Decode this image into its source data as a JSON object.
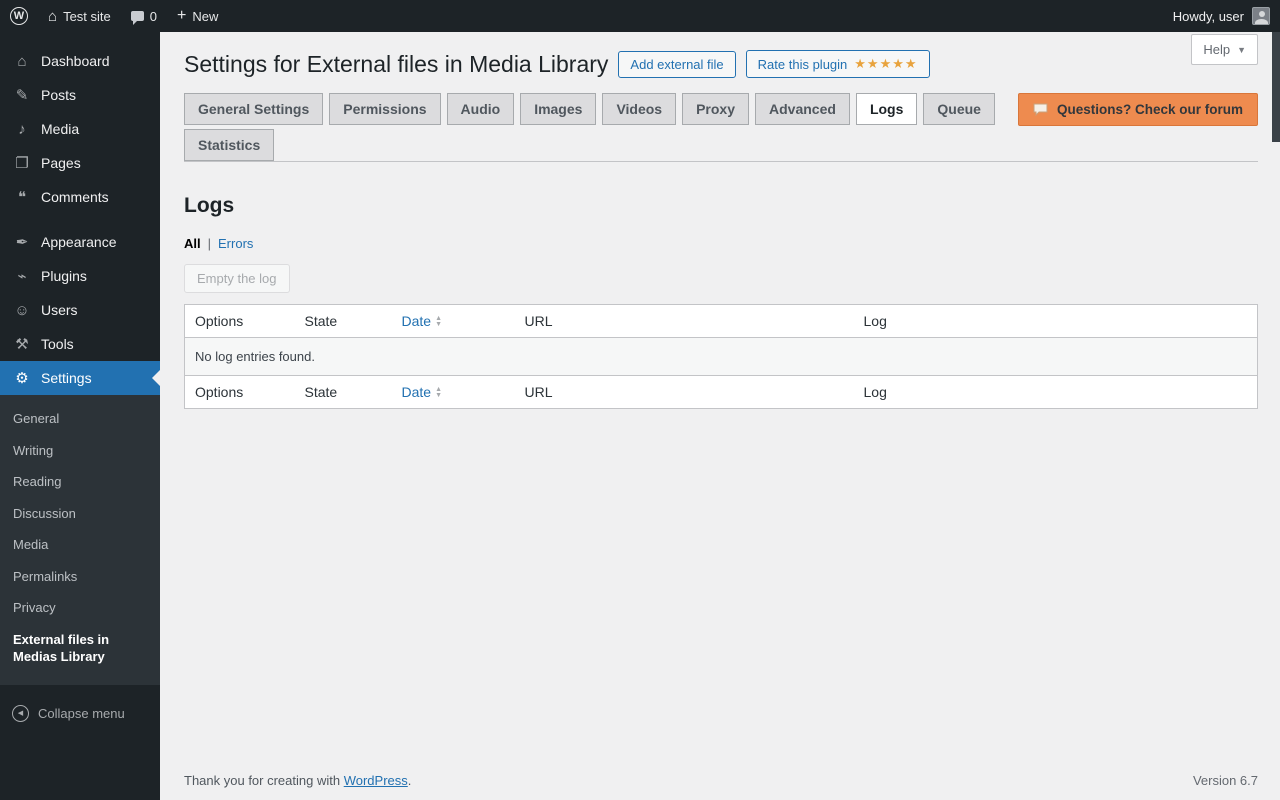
{
  "colors": {
    "accent_blue": "#2271b1",
    "admin_dark": "#1d2327",
    "forum_orange": "#ee8b4f",
    "star_orange": "#e8a33d",
    "content_bg": "#f0f0f1"
  },
  "admin_bar": {
    "site_name": "Test site",
    "comment_count": "0",
    "new_label": "New",
    "howdy_text": "Howdy, user"
  },
  "icons": {
    "wordpress_logo": "W",
    "home": "⌂",
    "plus": "+",
    "dashboard": "⌂",
    "posts": "✎",
    "media": "♪",
    "pages": "❐",
    "comments": "❝",
    "appearance": "✒",
    "plugins": "⌁",
    "users": "☺",
    "tools": "⚒",
    "settings": "⚙",
    "collapse_arrow": "◀",
    "caret_down": "▼",
    "sort_up": "▲",
    "sort_down": "▼"
  },
  "sidebar": {
    "items": [
      {
        "label": "Dashboard"
      },
      {
        "label": "Posts"
      },
      {
        "label": "Media"
      },
      {
        "label": "Pages"
      },
      {
        "label": "Comments"
      },
      {
        "label": "Appearance"
      },
      {
        "label": "Plugins"
      },
      {
        "label": "Users"
      },
      {
        "label": "Tools"
      },
      {
        "label": "Settings"
      }
    ],
    "settings_submenu": [
      "General",
      "Writing",
      "Reading",
      "Discussion",
      "Media",
      "Permalinks",
      "Privacy",
      "External files in Medias Library"
    ],
    "collapse_label": "Collapse menu"
  },
  "help": {
    "label": "Help"
  },
  "page": {
    "title": "Settings for External files in Media Library",
    "add_external_file_label": "Add external file",
    "rate_plugin_label": "Rate this plugin",
    "rate_stars": "★★★★★",
    "forum_button_label": "Questions? Check our forum"
  },
  "tabs": [
    {
      "label": "General Settings",
      "active": false
    },
    {
      "label": "Permissions",
      "active": false
    },
    {
      "label": "Audio",
      "active": false
    },
    {
      "label": "Images",
      "active": false
    },
    {
      "label": "Videos",
      "active": false
    },
    {
      "label": "Proxy",
      "active": false
    },
    {
      "label": "Advanced",
      "active": false
    },
    {
      "label": "Logs",
      "active": true
    },
    {
      "label": "Queue",
      "active": false
    },
    {
      "label": "Statistics",
      "active": false
    }
  ],
  "logs": {
    "heading": "Logs",
    "filters": {
      "all": "All",
      "separator": "|",
      "errors": "Errors"
    },
    "empty_log_button": "Empty the log",
    "table": {
      "columns": [
        "Options",
        "State",
        "Date",
        "URL",
        "Log"
      ],
      "empty_message": "No log entries found."
    }
  },
  "footer": {
    "thanks_prefix": "Thank you for creating with",
    "wordpress_link": "WordPress",
    "suffix": ".",
    "version": "Version 6.7"
  }
}
